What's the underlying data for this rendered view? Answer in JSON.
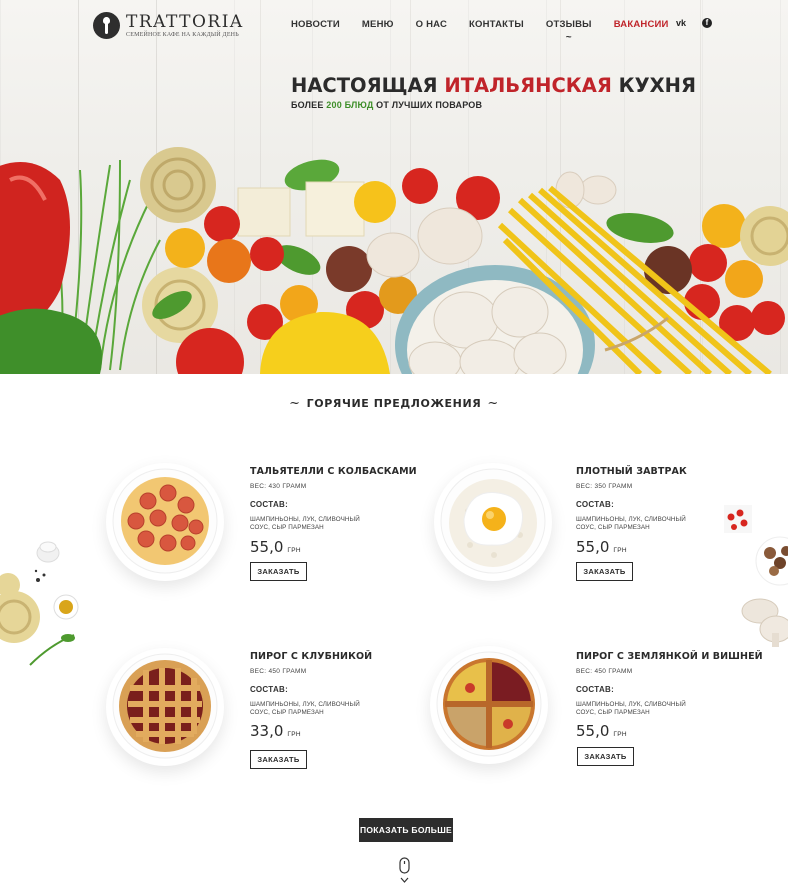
{
  "brand": {
    "name": "TRATTORIA",
    "tagline": "СЕМЕЙНОЕ КАФЕ НА КАЖДЫЙ ДЕНЬ"
  },
  "nav": {
    "items": [
      {
        "label": "НОВОСТИ"
      },
      {
        "label": "МЕНЮ"
      },
      {
        "label": "О НАС"
      },
      {
        "label": "КОНТАКТЫ"
      },
      {
        "label": "ОТЗЫВЫ"
      },
      {
        "label": "ВАКАНСИИ"
      }
    ],
    "active_marker": "~"
  },
  "social": {
    "vk": "vk",
    "fb": "f"
  },
  "hero": {
    "title_part1": "НАСТОЯЩАЯ ",
    "title_accent": "ИТАЛЬЯНСКАЯ",
    "title_part2": " КУХНЯ",
    "subtitle_part1": "БОЛЕЕ ",
    "subtitle_accent": "200 БЛЮД",
    "subtitle_part2": " ОТ ЛУЧШИХ ПОВАРОВ"
  },
  "section": {
    "title": "ГОРЯЧИЕ ПРЕДЛОЖЕНИЯ",
    "swash_left": "~",
    "swash_right": "~"
  },
  "dishes": [
    {
      "title": "ТАЛЬЯТЕЛЛИ С КОЛБАСКАМИ",
      "weight": "ВЕС: 430 ГРАММ",
      "composition_label": "СОСТАВ:",
      "composition": "ШАМПИНЬОНЫ, ЛУК, СЛИВОЧНЫЙ СОУС, СЫР ПАРМЕЗАН",
      "price": "55,0",
      "currency": "ГРН",
      "button": "ЗАКАЗАТЬ",
      "image": "pasta-sausage"
    },
    {
      "title": "ПЛОТНЫЙ ЗАВТРАК",
      "weight": "ВЕС: 350 ГРАММ",
      "composition_label": "СОСТАВ:",
      "composition": "ШАМПИНЬОНЫ, ЛУК, СЛИВОЧНЫЙ СОУС, СЫР ПАРМЕЗАН",
      "price": "55,0",
      "currency": "ГРН",
      "button": "ЗАКАЗАТЬ",
      "image": "fried-egg-rice"
    },
    {
      "title": "ПИРОГ С КЛУБНИКОЙ",
      "weight": "ВЕС: 450 ГРАММ",
      "composition_label": "СОСТАВ:",
      "composition": "ШАМПИНЬОНЫ, ЛУК, СЛИВОЧНЫЙ СОУС, СЫР ПАРМЕЗАН",
      "price": "33,0",
      "currency": "ГРН",
      "button": "ЗАКАЗАТЬ",
      "image": "lattice-pie"
    },
    {
      "title": "ПИРОГ С ЗЕМЛЯНКОЙ И ВИШНЕЙ",
      "weight": "ВЕС: 450 ГРАММ",
      "composition_label": "СОСТАВ:",
      "composition": "ШАМПИНЬОНЫ, ЛУК, СЛИВОЧНЫЙ СОУС, СЫР ПАРМЕЗАН",
      "price": "55,0",
      "currency": "ГРН",
      "button": "ЗАКАЗАТЬ",
      "image": "berry-tart"
    }
  ],
  "show_more": "ПОКАЗАТЬ БОЛЬШЕ",
  "colors": {
    "accent_red": "#c0242a",
    "accent_green": "#3f8f2a",
    "dark": "#2d2d2d"
  },
  "icons": [
    "logo-icon",
    "vk-icon",
    "facebook-icon",
    "scroll-mouse-icon"
  ]
}
